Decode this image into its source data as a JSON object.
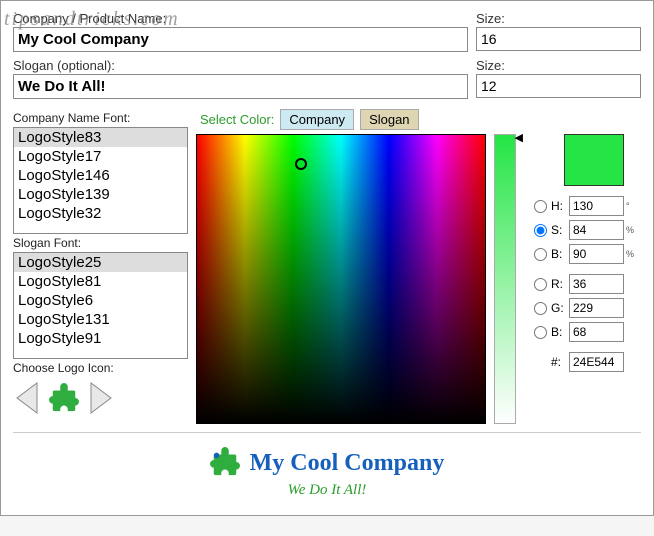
{
  "watermark": "tipsandtricks.com",
  "fields": {
    "company_label": "Company / Product Name:",
    "company_value": "My Cool Company",
    "company_size_label": "Size:",
    "company_size_value": "16",
    "slogan_label": "Slogan (optional):",
    "slogan_value": "We Do It All!",
    "slogan_size_label": "Size:",
    "slogan_size_value": "12"
  },
  "fonts": {
    "company_label": "Company Name Font:",
    "company_options": [
      "LogoStyle83",
      "LogoStyle17",
      "LogoStyle146",
      "LogoStyle139",
      "LogoStyle32"
    ],
    "company_selected": "LogoStyle83",
    "slogan_label": "Slogan Font:",
    "slogan_options": [
      "LogoStyle25",
      "LogoStyle81",
      "LogoStyle6",
      "LogoStyle131",
      "LogoStyle91"
    ],
    "slogan_selected": "LogoStyle25",
    "icon_label": "Choose Logo Icon:"
  },
  "picker": {
    "select_label": "Select Color:",
    "tab_company": "Company",
    "tab_slogan": "Slogan",
    "hue_label": "H:",
    "hue_value": "130",
    "hue_unit": "°",
    "sat_label": "S:",
    "sat_value": "84",
    "sat_unit": "%",
    "bri_label": "B:",
    "bri_value": "90",
    "bri_unit": "%",
    "r_label": "R:",
    "r_value": "36",
    "g_label": "G:",
    "g_value": "229",
    "b_label": "B:",
    "b_value": "68",
    "hex_label": "#:",
    "hex_value": "24E544",
    "swatch_color": "#24E544"
  },
  "preview": {
    "company": "My Cool Company",
    "slogan": "We Do It All!"
  }
}
